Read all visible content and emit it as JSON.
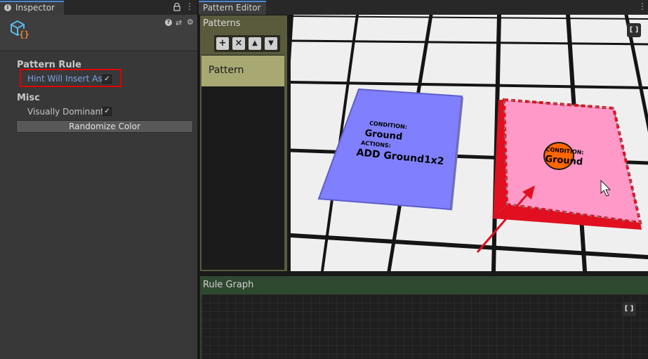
{
  "inspector": {
    "tab_label": "Inspector",
    "sections": {
      "pattern_rule": "Pattern Rule",
      "misc": "Misc"
    },
    "hint_field": {
      "label": "Hint Will Insert Ass",
      "checked": "✓"
    },
    "visually_dominant": {
      "label": "Visually Dominant",
      "checked": "✓"
    },
    "randomize_button": "Randomize Color"
  },
  "pattern_editor": {
    "tab_label": "Pattern Editor",
    "patterns_title": "Patterns",
    "toolbar": {
      "add": "+",
      "remove": "×",
      "up": "▲",
      "down": "▼"
    },
    "items": [
      {
        "label": "Pattern"
      }
    ],
    "scene": {
      "blue_tile": {
        "condition": "CONDITION:",
        "condition_value": "Ground",
        "actions": "ACTIONS:",
        "action_value": "ADD Ground1x2",
        "color": "#8080ff"
      },
      "pink_tile": {
        "condition": "CONDITION:",
        "condition_value": "Ground",
        "color": "#ff99c8"
      }
    }
  },
  "rule_graph": {
    "title": "Rule Graph"
  },
  "colors": {
    "accent_tab": "#4a88d8",
    "highlight": "#e00000",
    "patterns_panel": "#595b3c",
    "selected_item": "#a8a873",
    "rule_graph": "#2f4830"
  }
}
